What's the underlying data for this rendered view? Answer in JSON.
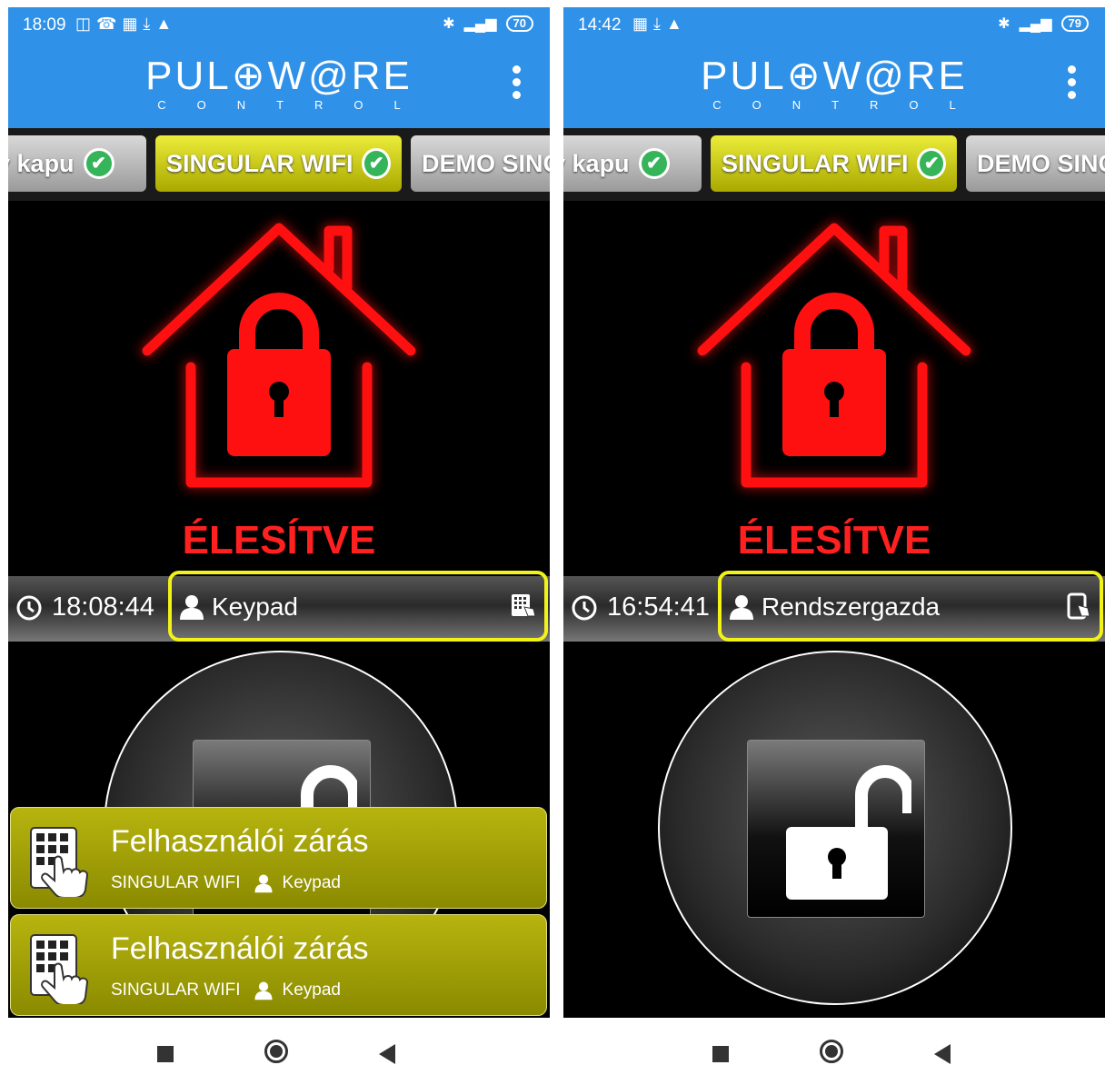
{
  "app": {
    "logo_main": "PUL⊕W@RE",
    "logo_sub": "CONTROL"
  },
  "screens": [
    {
      "status_bar": {
        "time": "18:09",
        "battery": "70"
      },
      "tabs": [
        {
          "label": "ay kapu",
          "checked": true
        },
        {
          "label": "SINGULAR WIFI",
          "checked": true,
          "active": true
        },
        {
          "label": "DEMO SINGULAR"
        }
      ],
      "state_label": "ÉLESÍTVE",
      "event": {
        "time": "18:08:44",
        "user": "Keypad",
        "source_icon": "keypad-icon"
      },
      "notifications": [
        {
          "title": "Felhasználói zárás",
          "device": "SINGULAR WIFI",
          "user": "Keypad"
        },
        {
          "title": "Felhasználói zárás",
          "device": "SINGULAR WIFI",
          "user": "Keypad"
        }
      ]
    },
    {
      "status_bar": {
        "time": "14:42",
        "battery": "79"
      },
      "tabs": [
        {
          "label": "ay kapu",
          "checked": true
        },
        {
          "label": "SINGULAR WIFI",
          "checked": true,
          "active": true
        },
        {
          "label": "DEMO SINGULAR"
        }
      ],
      "state_label": "ÉLESÍTVE",
      "event": {
        "time": "16:54:41",
        "user": "Rendszergazda",
        "source_icon": "phone-touch-icon"
      }
    }
  ],
  "colors": {
    "app_bar": "#2f91e8",
    "armed": "#ff2020",
    "active_tab": "#d4d41c",
    "highlight": "#f2f218",
    "check": "#35b45a"
  }
}
